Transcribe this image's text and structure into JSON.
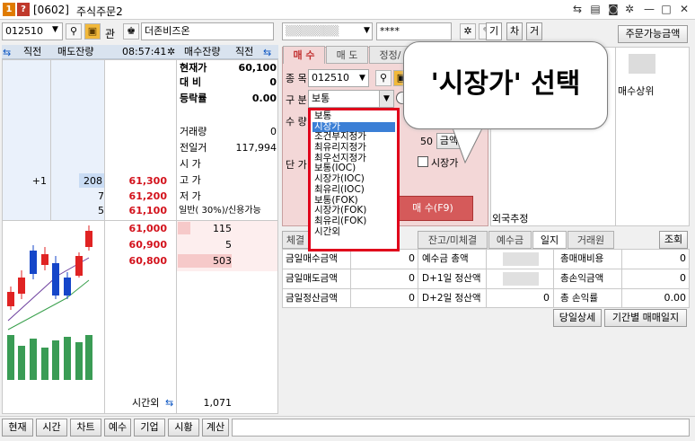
{
  "titlebar": {
    "num_badge": "1",
    "help_badge": "?",
    "screen_code": "[0602]",
    "title": "주식주문2"
  },
  "left_panel": {
    "stock_code": "012510",
    "stock_name": "더존비즈온",
    "hoga_header": {
      "c1": "직전",
      "c2": "매도잔량",
      "time": "08:57:41",
      "c3": "매수잔량",
      "c4": "직전"
    },
    "sell_rows": [
      {
        "prev": "+1",
        "qty": "208",
        "price": "61,300"
      },
      {
        "prev": "7",
        "qty": "",
        "price": "61,200"
      },
      {
        "prev": "5",
        "qty": "",
        "price": "61,100"
      }
    ],
    "buy_rows": [
      {
        "price": "61,000",
        "qty": "115"
      },
      {
        "price": "60,900",
        "qty": "5"
      },
      {
        "price": "60,800",
        "qty": "503"
      }
    ],
    "info": {
      "cur_label": "현재가",
      "cur_value": "60,100",
      "diff_label": "대 비",
      "diff_value": "0",
      "rate_label": "등락률",
      "rate_value": "0.00",
      "vol_label": "거래량",
      "vol_value": "0",
      "prev_vol_label": "전일거",
      "prev_vol_value": "117,994",
      "open_label": "시 가",
      "high_label": "고 가",
      "low_label": "저 가",
      "credit_text": "일반( 30%)/신용가능"
    },
    "after_hours_label": "시간외",
    "after_hours_value": "1,071",
    "chart_label": "차트"
  },
  "order_panel": {
    "account_masked": "****",
    "right_buttons": [
      "기",
      "차",
      "거"
    ],
    "available_btn": "주문가능금액",
    "tabs": [
      "매 수",
      "매 도",
      "정정/"
    ],
    "item_label": "종 목",
    "item_value": "012510",
    "type_label": "구 분",
    "type_value": "보통",
    "qty_label": "수 량",
    "price_label": "단 가",
    "qty_unit_val": "50",
    "amount_btn": "금액",
    "market_check": "시장가",
    "buy_btn": "매 수(F9)",
    "dropdown_options": [
      "보통",
      "시장가",
      "조건부지정가",
      "최유리지정가",
      "최우선지정가",
      "보통(IOC)",
      "시장가(IOC)",
      "최유리(IOC)",
      "보통(FOK)",
      "시장가(FOK)",
      "최유리(FOK)",
      "시간외"
    ],
    "dropdown_selected": "시장가",
    "right_col_label": "매수상위",
    "foreign_label": "외국추정"
  },
  "callout": {
    "text": "'시장가' 선택"
  },
  "bottom_tabs": {
    "tabs": [
      "체결",
      "잔고/미체결",
      "예수금",
      "일지",
      "거래원"
    ],
    "inquiry_btn": "조회",
    "rows": [
      {
        "a": "금일매수금액",
        "av": "0",
        "b": "예수금 총액",
        "bv": "",
        "c": "총매매비용",
        "cv": "0"
      },
      {
        "a": "금일매도금액",
        "av": "0",
        "b": "D+1일 정산액",
        "bv": "",
        "c": "총손익금액",
        "cv": "0"
      },
      {
        "a": "금일정산금액",
        "av": "0",
        "b": "D+2일 정산액",
        "bv": "0",
        "c": "총 손익률",
        "cv": "0.00"
      }
    ],
    "detail_btn": "당일상세",
    "period_btn": "기간별 매매일지"
  },
  "statusbar": {
    "buttons": [
      "현재",
      "시간",
      "차트",
      "예수",
      "기업",
      "시황",
      "계산"
    ]
  }
}
